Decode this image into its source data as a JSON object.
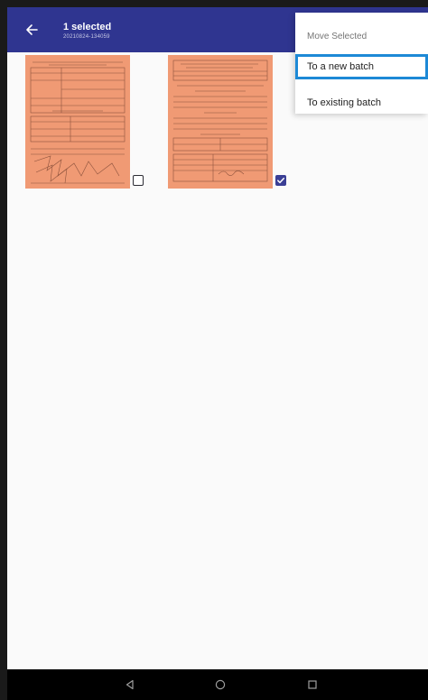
{
  "appbar": {
    "title": "1 selected",
    "subtitle": "20210824-134059"
  },
  "icons": {
    "back": "arrow-left-icon",
    "nav_back": "triangle-back-icon",
    "nav_home": "circle-home-icon",
    "nav_recents": "square-recents-icon"
  },
  "colors": {
    "appbar": "#2f3590",
    "thumbnail": "#f09a74",
    "checkbox_checked": "#3b3f95",
    "highlight_border": "#1d89d6"
  },
  "images": [
    {
      "selected": false
    },
    {
      "selected": true
    }
  ],
  "menu": {
    "title": "Move Selected",
    "items": [
      {
        "label": "To a new batch"
      },
      {
        "label": "To existing batch"
      }
    ]
  }
}
